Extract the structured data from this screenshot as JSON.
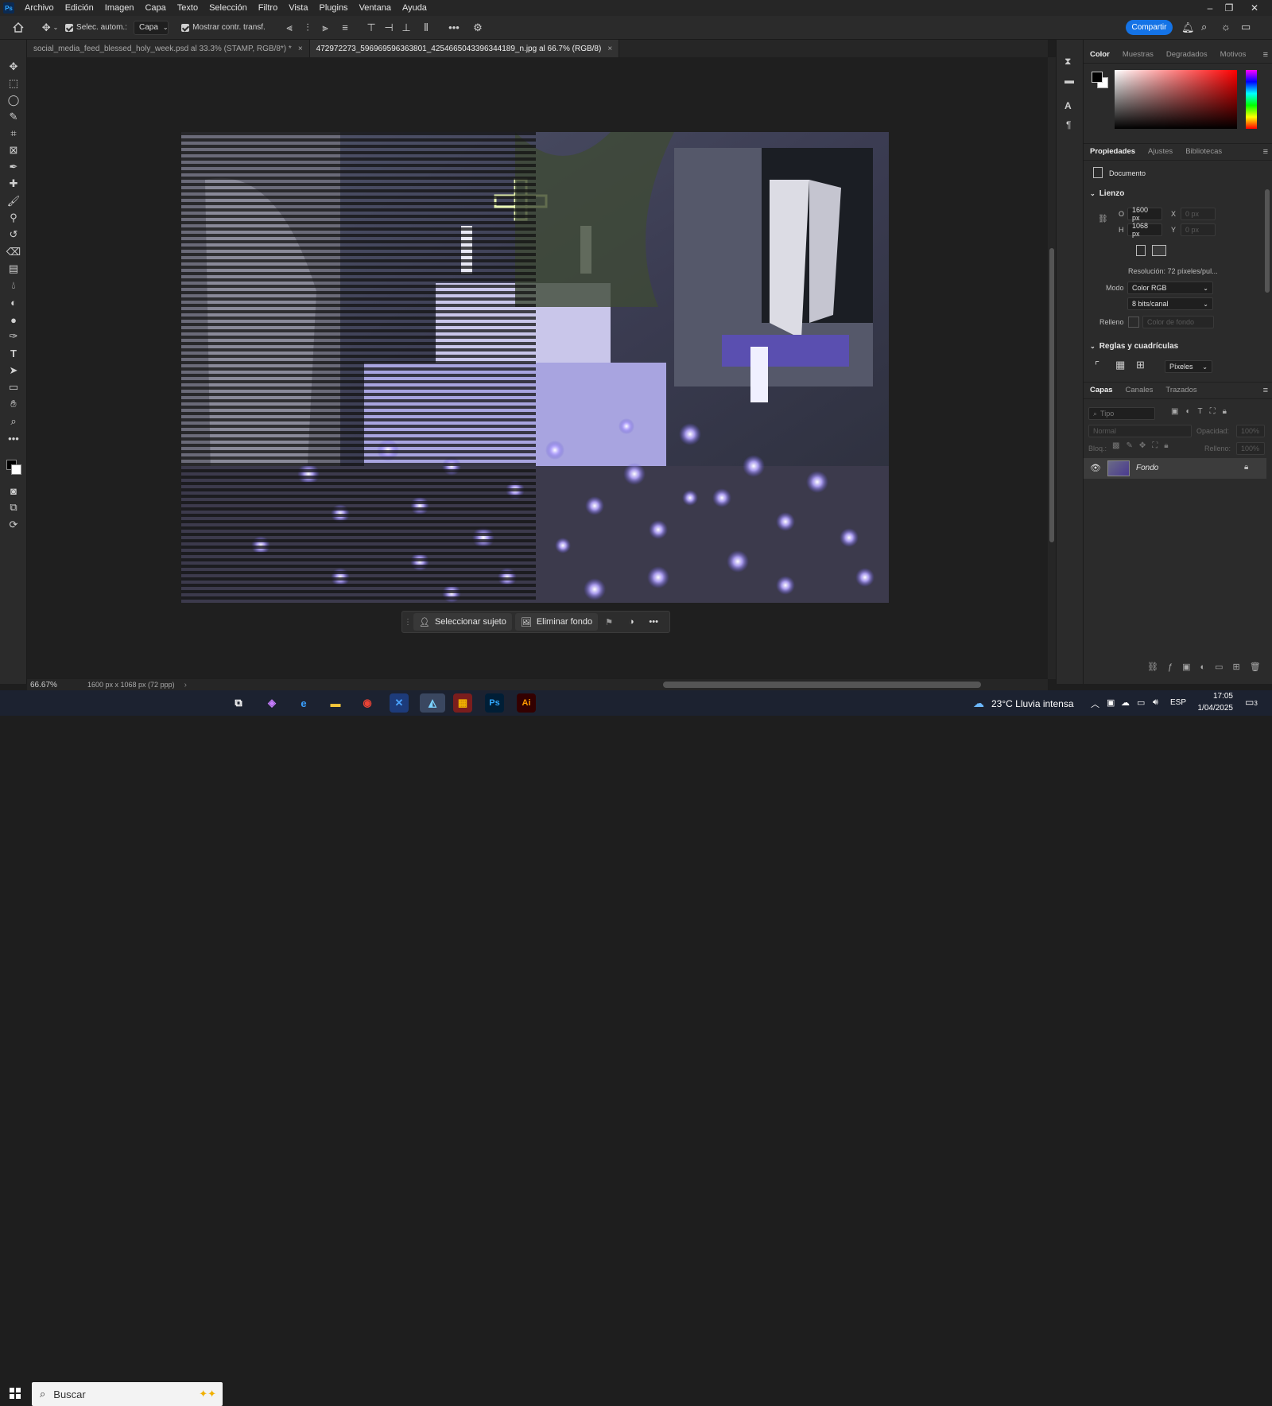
{
  "menubar": {
    "logo": "Ps",
    "items": [
      "Archivo",
      "Edición",
      "Imagen",
      "Capa",
      "Texto",
      "Selección",
      "Filtro",
      "Vista",
      "Plugins",
      "Ventana",
      "Ayuda"
    ]
  },
  "options": {
    "auto_select_label": "Selec. autom.:",
    "auto_select_value": "Capa",
    "show_transform_label": "Mostrar contr. transf.",
    "share_label": "Compartir"
  },
  "tabs": [
    {
      "label": "social_media_feed_blessed_holy_week.psd al 33.3% (STAMP, RGB/8*) *",
      "active": false
    },
    {
      "label": "472972273_596969596363801_4254665043396344189_n.jpg al 66.7% (RGB/8)",
      "active": true
    }
  ],
  "contextbar": {
    "select_subject": "Seleccionar sujeto",
    "remove_bg": "Eliminar fondo"
  },
  "status": {
    "zoom": "66.67%",
    "doc_info": "1600 px x 1068 px (72 ppp)"
  },
  "color_panel": {
    "tabs": [
      "Color",
      "Muestras",
      "Degradados",
      "Motivos"
    ],
    "active": "Color",
    "foreground": "#000000",
    "background": "#ffffff"
  },
  "properties": {
    "tabs": [
      "Propiedades",
      "Ajustes",
      "Bibliotecas"
    ],
    "doc_label": "Documento",
    "canvas_title": "Lienzo",
    "w_label": "O",
    "w_value": "1600 px",
    "h_label": "H",
    "h_value": "1068 px",
    "x_label": "X",
    "x_value": "0 px",
    "y_label": "Y",
    "y_value": "0 px",
    "resolution": "Resolución: 72 píxeles/pul...",
    "mode_label": "Modo",
    "mode_value": "Color RGB",
    "bits_value": "8 bits/canal",
    "fill_label": "Relleno",
    "fill_value": "Color de fondo",
    "rulers_title": "Reglas y cuadrículas",
    "units_value": "Píxeles"
  },
  "layers": {
    "tabs": [
      "Capas",
      "Canales",
      "Trazados"
    ],
    "search_placeholder": "Tipo",
    "blend": "Normal",
    "opacity_label": "Opacidad:",
    "opacity_value": "100%",
    "lock_label": "Bloq.:",
    "fill_label": "Relleno:",
    "fill_value": "100%",
    "items": [
      {
        "name": "Fondo"
      }
    ]
  },
  "taskbar": {
    "search_placeholder": "Buscar",
    "weather": "23°C  Lluvia intensa",
    "lang": "ESP",
    "time": "17:05",
    "date": "1/04/2025",
    "notif_count": "3"
  }
}
